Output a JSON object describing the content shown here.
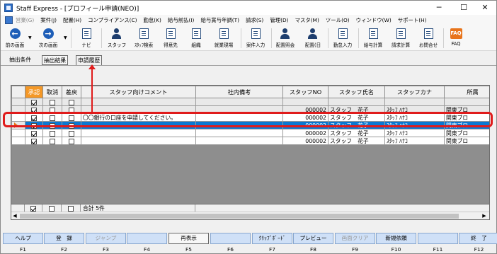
{
  "window": {
    "title": "Staff Express - [プロフィール申請(NEO)]",
    "minimize": "─",
    "maximize": "☐",
    "close": "✕"
  },
  "menu": [
    {
      "label": "営業(G)",
      "disabled": true
    },
    {
      "label": "案件(J)"
    },
    {
      "label": "配置(H)"
    },
    {
      "label": "コンプライアンス(C)"
    },
    {
      "label": "勤怠(K)"
    },
    {
      "label": "給与前払(I)"
    },
    {
      "label": "給与賞与年調(T)"
    },
    {
      "label": "請求(S)"
    },
    {
      "label": "管理(D)"
    },
    {
      "label": "マスタ(M)"
    },
    {
      "label": "ツール(O)"
    },
    {
      "label": "ウィンドウ(W)"
    },
    {
      "label": "サポート(H)"
    }
  ],
  "toolbar": {
    "back": "前の画面",
    "forward": "次の画面",
    "navi": "ナビ",
    "staff": "スタッフ",
    "staff_search": "ｽﾀｯﾌ検索",
    "client": "得意先",
    "org": "組織",
    "site": "就業現場",
    "job_entry": "案件入力",
    "placement_inquiry": "配置照会",
    "placement_day": "配置(日",
    "attendance": "勤怠入力",
    "payroll": "給与計算",
    "billing": "請求計算",
    "inquiry": "お問合せ",
    "faq": "FAQ"
  },
  "condition_tabs": {
    "extract_condition": "抽出条件",
    "extract_result": "抽出結果",
    "history": "申請履歴"
  },
  "grid": {
    "columns": [
      "承認",
      "取消",
      "差戻",
      "スタッフ向けコメント",
      "社内備考",
      "スタッフNO",
      "スタッフ氏名",
      "スタッフカナ",
      "所属"
    ],
    "rows": [
      {
        "approve": true,
        "cancel": false,
        "reject": false,
        "comment": "",
        "memo": "",
        "staff_no": "",
        "name": "",
        "kana": "",
        "dept": "",
        "selected": false,
        "gray": true
      },
      {
        "approve": true,
        "cancel": false,
        "reject": false,
        "comment": "",
        "memo": "",
        "staff_no": "000002",
        "name": "スタッフ　花子",
        "kana": "ｽﾀｯﾌ ﾊﾅｺ",
        "dept": "関東ブロ",
        "selected": false,
        "gray": true
      },
      {
        "approve": true,
        "cancel": false,
        "reject": false,
        "comment": "〇〇銀行の口座を申請してください。",
        "memo": "",
        "staff_no": "000002",
        "name": "スタッフ　花子",
        "kana": "ｽﾀｯﾌ ﾊﾅｺ",
        "dept": "関東ブロ",
        "selected": false,
        "gray": false
      },
      {
        "approve": true,
        "cancel": false,
        "reject": false,
        "comment": "",
        "memo": "",
        "staff_no": "000002",
        "name": "スタッフ　花子",
        "kana": "ｽﾀｯﾌ ﾊﾅｺ",
        "dept": "関東ブロ",
        "selected": true,
        "gray": false
      },
      {
        "approve": true,
        "cancel": false,
        "reject": false,
        "comment": "",
        "memo": "",
        "staff_no": "000002",
        "name": "スタッフ　花子",
        "kana": "ｽﾀｯﾌ ﾊﾅｺ",
        "dept": "関東ブロ",
        "selected": false,
        "gray": false
      },
      {
        "approve": true,
        "cancel": false,
        "reject": false,
        "comment": "",
        "memo": "",
        "staff_no": "000002",
        "name": "スタッフ　花子",
        "kana": "ｽﾀｯﾌ ﾊﾅｺ",
        "dept": "関東ブロ",
        "selected": false,
        "gray": false
      }
    ],
    "total_label": "合計 5件"
  },
  "fkeys": [
    {
      "label": "ヘルプ",
      "key": "F1"
    },
    {
      "label": "登　録",
      "key": "F2"
    },
    {
      "label": "ジャンプ",
      "key": "F3",
      "disabled": true
    },
    {
      "label": "",
      "key": "F4"
    },
    {
      "label": "再表示",
      "key": "F5",
      "white": true
    },
    {
      "label": "",
      "key": "F6"
    },
    {
      "label": "ｸﾘｯﾌﾟﾎﾞｰﾄﾞ",
      "key": "F7"
    },
    {
      "label": "プレビュー",
      "key": "F8"
    },
    {
      "label": "画面クリア",
      "key": "F9",
      "disabled": true
    },
    {
      "label": "新規依頼",
      "key": "F10"
    },
    {
      "label": "",
      "key": "F11"
    },
    {
      "label": "終　了",
      "key": "F12"
    }
  ],
  "colors": {
    "approve_header": "#f59826",
    "selection": "#0a78d2",
    "annotation": "#e01b1b"
  }
}
